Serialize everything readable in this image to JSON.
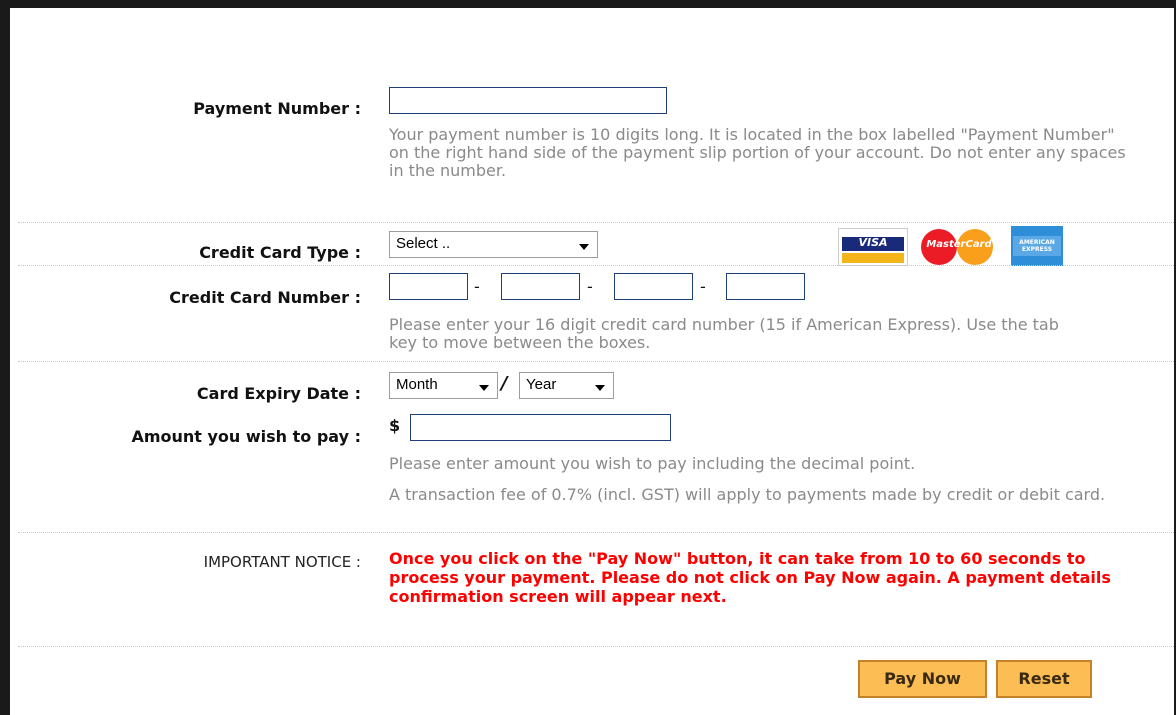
{
  "form": {
    "payment_number": {
      "label": "Payment Number :",
      "value": "",
      "help": "Your payment number is 10 digits long. It is located in the box labelled \"Payment Number\" on the right hand side of the payment slip portion of your account. Do not enter any spaces in the number."
    },
    "card_type": {
      "label": "Credit Card Type :",
      "selected": "Select ..",
      "logos": [
        "VISA",
        "MasterCard",
        "AMERICAN EXPRESS"
      ]
    },
    "card_number": {
      "label": "Credit Card Number :",
      "separator": "-",
      "parts": [
        "",
        "",
        "",
        ""
      ],
      "help": "Please enter your 16 digit credit card number (15 if American Express). Use the tab key to move between the boxes."
    },
    "expiry": {
      "label": "Card Expiry Date :",
      "month_selected": "Month",
      "separator": "/",
      "year_selected": "Year"
    },
    "amount": {
      "label": "Amount you wish to pay :",
      "currency": "$",
      "value": "",
      "help": "Please enter amount you wish to pay including the decimal point.",
      "fee_note": "A transaction fee of 0.7% (incl. GST) will apply to payments made by credit or debit card."
    },
    "notice": {
      "label": "IMPORTANT NOTICE :",
      "text": "Once you click on the \"Pay Now\" button, it can take from 10 to 60 seconds to process your payment. Please do not click on Pay Now again. A payment details confirmation screen will appear next."
    },
    "buttons": {
      "pay_now": "Pay Now",
      "reset": "Reset"
    }
  }
}
